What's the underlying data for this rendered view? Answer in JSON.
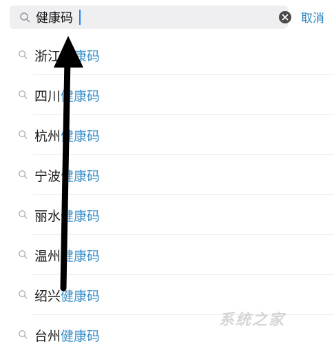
{
  "search": {
    "value": "健康码",
    "cancel_label": "取消"
  },
  "suggestions": [
    {
      "city": "浙江",
      "keyword": "健康码"
    },
    {
      "city": "四川",
      "keyword": "健康码"
    },
    {
      "city": "杭州",
      "keyword": "健康码"
    },
    {
      "city": "宁波",
      "keyword": "健康码"
    },
    {
      "city": "丽水",
      "keyword": "健康码"
    },
    {
      "city": "温州",
      "keyword": "健康码"
    },
    {
      "city": "绍兴",
      "keyword": "健康码"
    },
    {
      "city": "台州",
      "keyword": "健康码"
    }
  ],
  "watermark": "系统之家",
  "colors": {
    "accent": "#3a8fc8",
    "cancel": "#2e86c1",
    "search_bg": "#efeff1",
    "arrow": "#000000"
  },
  "icons": [
    "search-icon",
    "clear-icon",
    "arrow-up-icon"
  ]
}
